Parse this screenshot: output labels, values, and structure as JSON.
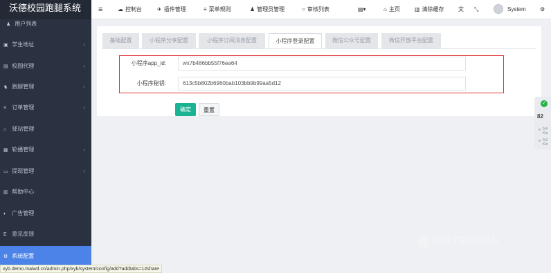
{
  "app": {
    "title": "沃德校园跑腿系统"
  },
  "sidebar": {
    "items": [
      {
        "icon": "user-icon",
        "glyph": "♟",
        "label": "用户列表",
        "caret": false
      },
      {
        "icon": "student-icon",
        "glyph": "▣",
        "label": "学生地址",
        "caret": true
      },
      {
        "icon": "school-icon",
        "glyph": "▤",
        "label": "校园代理",
        "caret": true
      },
      {
        "icon": "runner-icon",
        "glyph": "♞",
        "label": "跑腿管理",
        "caret": true
      },
      {
        "icon": "order-icon",
        "glyph": "≡",
        "label": "订单管理",
        "caret": true
      },
      {
        "icon": "home-icon",
        "glyph": "⌂",
        "label": "驿站管理",
        "caret": false
      },
      {
        "icon": "image-icon",
        "glyph": "▦",
        "label": "轮播管理",
        "caret": true
      },
      {
        "icon": "withdraw-icon",
        "glyph": "▭",
        "label": "提现管理",
        "caret": true
      },
      {
        "icon": "chart-icon",
        "glyph": "▥",
        "label": "帮助中心",
        "caret": false
      },
      {
        "icon": "ad-icon",
        "glyph": "◐",
        "label": "广告管理",
        "caret": false
      },
      {
        "icon": "feedback-icon",
        "glyph": "E",
        "label": "意见反馈",
        "caret": false
      },
      {
        "icon": "gear-icon",
        "glyph": "⚙",
        "label": "系统配置",
        "caret": false
      }
    ],
    "caret_glyph": "‹"
  },
  "header": {
    "menu_glyph": "≡",
    "nav": [
      {
        "icon": "dashboard-icon",
        "glyph": "☁",
        "label": "控制台"
      },
      {
        "icon": "plugin-icon",
        "glyph": "✈",
        "label": "插件管理"
      },
      {
        "icon": "menu-icon",
        "glyph": "≡",
        "label": "菜单规则"
      },
      {
        "icon": "admin-icon",
        "glyph": "♟",
        "label": "管理员管理"
      },
      {
        "icon": "circle-icon",
        "glyph": "○",
        "label": "审核列表"
      }
    ],
    "right": [
      {
        "icon": "list-dropdown-icon",
        "glyph": "▤▾",
        "label": ""
      },
      {
        "icon": "home-icon",
        "glyph": "⌂",
        "label": "主页"
      },
      {
        "icon": "trash-icon",
        "glyph": "▥",
        "label": "清除缓存"
      },
      {
        "icon": "translate-icon",
        "glyph": "⽂",
        "label": ""
      },
      {
        "icon": "fullscreen-icon",
        "glyph": "⤡",
        "label": ""
      }
    ],
    "user": "System",
    "settings_glyph": "⚙"
  },
  "tabs": [
    {
      "label": "基础配置",
      "active": false
    },
    {
      "label": "小程序分享配置",
      "active": false
    },
    {
      "label": "小程序订阅消息配置",
      "active": false
    },
    {
      "label": "小程序登录配置",
      "active": true
    },
    {
      "label": "微信公众号配置",
      "active": false
    },
    {
      "label": "微信开放平台配置",
      "active": false
    }
  ],
  "form": {
    "fields": [
      {
        "label": "小程序app_id:",
        "value": "wx7b486bb55f76ea64"
      },
      {
        "label": "小程序秘钥:",
        "value": "613c5b802b6960bab103bb9b99aa5d12"
      }
    ],
    "submit_label": "确定",
    "reset_label": "重置"
  },
  "widget": {
    "score": "82",
    "badge_glyph": "✓",
    "stats": [
      "0.4",
      "K/s",
      "0.3",
      "K/s"
    ]
  },
  "watermark": {
    "text": "INSTRONHN"
  },
  "statusbar": {
    "url": "xyb.demo.maiwd.cn/admin.php/xyb/system/config/add?addtabs=1#share"
  },
  "colors": {
    "sidebar_bg": "#2a3140",
    "active_bg": "#4b83e8",
    "primary_btn": "#1ab394",
    "highlight_border": "#e0312f"
  }
}
